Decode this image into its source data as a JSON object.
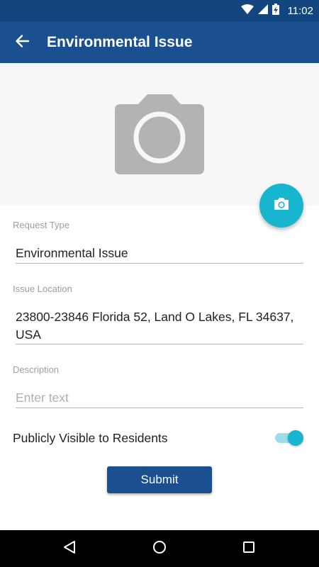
{
  "status_bar": {
    "time": "11:02",
    "icons": [
      "wifi-icon",
      "cell-signal-icon",
      "battery-charging-icon"
    ]
  },
  "app_bar": {
    "title": "Environmental Issue",
    "back_icon": "arrow-left-icon"
  },
  "photo": {
    "placeholder_icon": "camera-icon",
    "fab_icon": "camera-icon"
  },
  "form": {
    "request_type": {
      "label": "Request Type",
      "value": "Environmental Issue"
    },
    "issue_location": {
      "label": "Issue Location",
      "value": "23800-23846 Florida 52, Land O Lakes, FL 34637, USA"
    },
    "description": {
      "label": "Description",
      "value": "",
      "placeholder": "Enter text"
    },
    "public_toggle": {
      "label": "Publicly Visible to Residents",
      "on": true
    },
    "submit_label": "Submit"
  },
  "nav_bar": {
    "icons": [
      "back-triangle-icon",
      "home-circle-icon",
      "recents-square-icon"
    ]
  },
  "colors": {
    "primary": "#1b5090",
    "status_bar": "#13467f",
    "accent": "#18b5cf"
  }
}
